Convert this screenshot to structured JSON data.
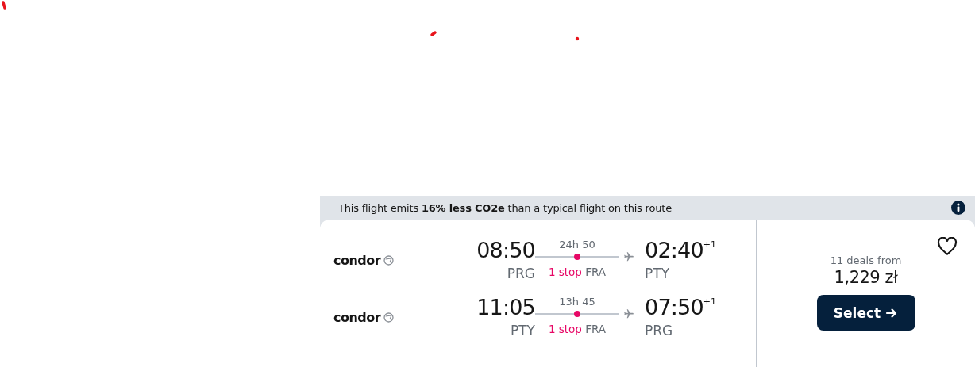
{
  "eco_banner": {
    "text": "This flight emits **16% less CO2e** than a typical flight on this route"
  },
  "legs": [
    {
      "airline": "condor",
      "depart_time": "08:50",
      "depart_airport": "PRG",
      "duration": "24h 50",
      "stops": "1 stop",
      "stop_airport": "FRA",
      "arrive_time": "02:40",
      "day_offset": "+1",
      "arrive_airport": "PTY"
    },
    {
      "airline": "condor",
      "depart_time": "11:05",
      "depart_airport": "PTY",
      "duration": "13h 45",
      "stops": "1 stop",
      "stop_airport": "FRA",
      "arrive_time": "07:50",
      "day_offset": "+1",
      "arrive_airport": "PRG"
    }
  ],
  "price": {
    "deals": "11 deals from",
    "amount": "1,229 zł",
    "button": "Select",
    "saved": false
  }
}
